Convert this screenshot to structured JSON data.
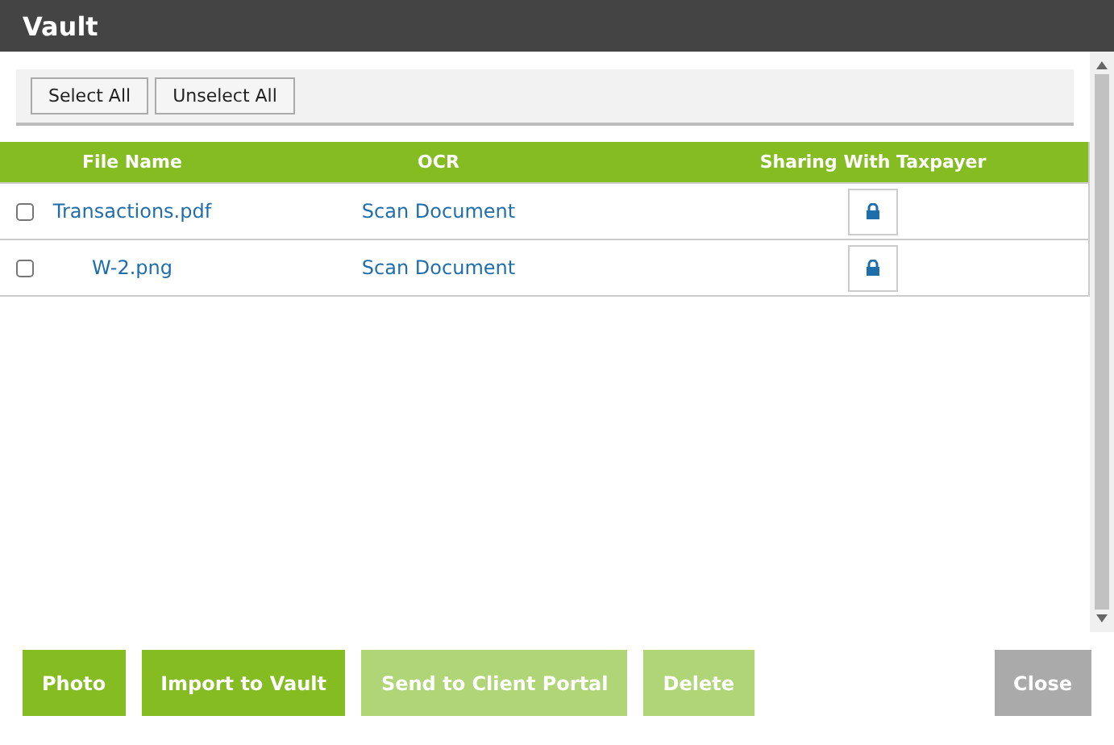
{
  "window": {
    "title": "Vault"
  },
  "toolbar": [
    {
      "label": "Select All"
    },
    {
      "label": "Unselect All"
    }
  ],
  "table": {
    "columns": [
      "File Name",
      "OCR",
      "Sharing With Taxpayer"
    ],
    "rows": [
      {
        "checked": false,
        "file_name": "Transactions.pdf",
        "ocr": "Scan Document",
        "locked": true
      },
      {
        "checked": false,
        "file_name": "W-2.png",
        "ocr": "Scan Document",
        "locked": true
      }
    ]
  },
  "buttons": [
    {
      "label": "Photo",
      "kind": "primary",
      "disabled": false
    },
    {
      "label": "Import to Vault",
      "kind": "primary",
      "disabled": false
    },
    {
      "label": "Send to Client Portal",
      "kind": "primary",
      "disabled": true
    },
    {
      "label": "Delete",
      "kind": "primary",
      "disabled": true
    },
    {
      "label": "Close",
      "kind": "secondary",
      "disabled": false
    }
  ]
}
